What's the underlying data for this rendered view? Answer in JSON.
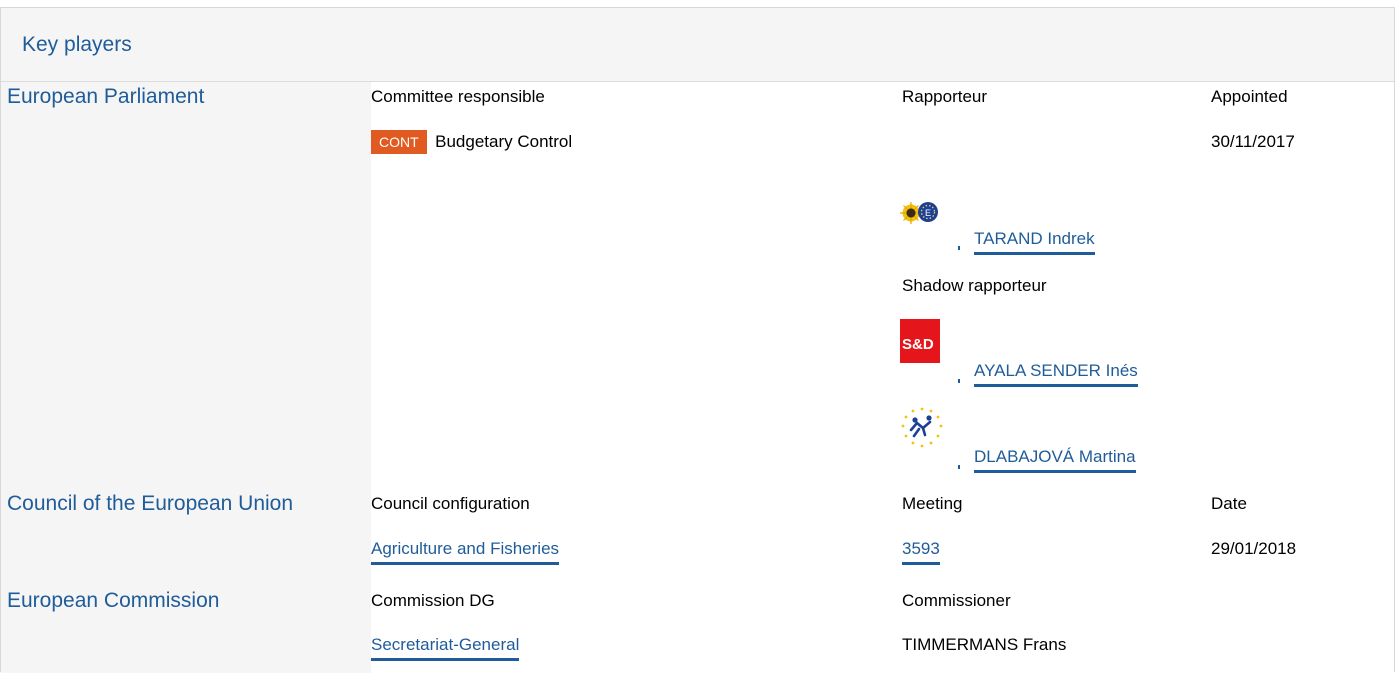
{
  "panel": {
    "title": "Key players"
  },
  "parliament": {
    "name": "European Parliament",
    "col_committee": "Committee responsible",
    "col_rapporteur": "Rapporteur",
    "col_appointed": "Appointed",
    "committee_code": "CONT",
    "committee_name": "Budgetary Control",
    "appointed_date": "30/11/2017",
    "rapporteur": {
      "name": "TARAND Indrek",
      "group_logo": "greens-efa-logo"
    },
    "shadow_label": "Shadow rapporteur",
    "shadows": [
      {
        "name": "AYALA SENDER Inés",
        "group_logo": "s-and-d-logo",
        "logo_text": "S&D"
      },
      {
        "name": "DLABAJOVÁ Martina",
        "group_logo": "alde-logo"
      }
    ],
    "badge_color": "#e05a21"
  },
  "council": {
    "name": "Council of the European Union",
    "col_configuration": "Council configuration",
    "col_meeting": "Meeting",
    "col_date": "Date",
    "configuration": "Agriculture and Fisheries",
    "meeting": "3593",
    "date": "29/01/2018"
  },
  "commission": {
    "name": "European Commission",
    "col_dg": "Commission DG",
    "col_commissioner": "Commissioner",
    "dg": "Secretariat-General",
    "commissioner": "TIMMERMANS Frans"
  },
  "colors": {
    "link": "#1f5c99",
    "header_bg": "#f5f5f5",
    "sd_red": "#e4161b"
  }
}
